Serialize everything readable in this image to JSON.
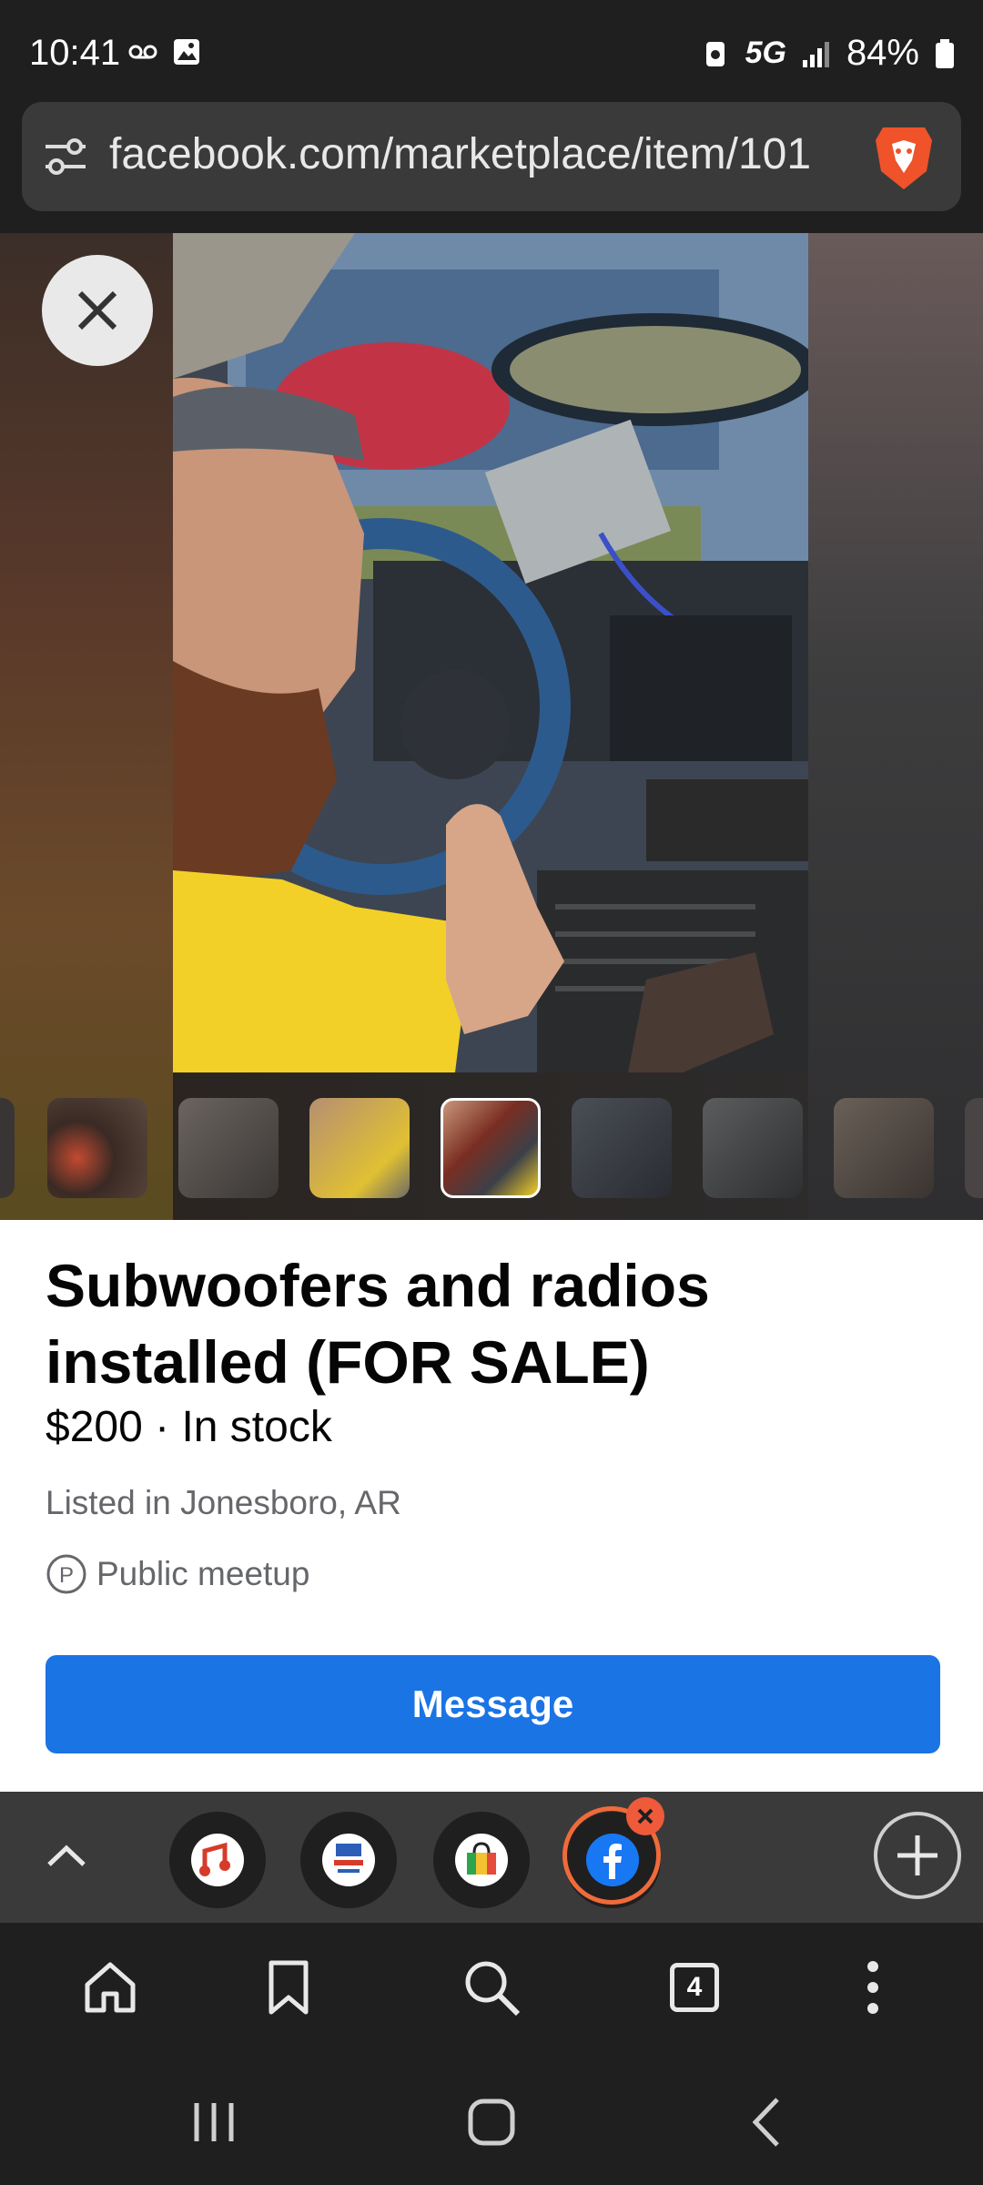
{
  "status_bar": {
    "time": "10:41",
    "network": "5G",
    "battery": "84%"
  },
  "url_bar": {
    "url": "facebook.com/marketplace/item/101"
  },
  "listing": {
    "title": "Subwoofers and radios installed (FOR SALE)",
    "price_line": "$200 · In stock",
    "location": "Listed in Jonesboro, AR",
    "meetup": "Public meetup",
    "message_button": "Message"
  },
  "thumbnails": {
    "count": 8,
    "selected_index": 3
  },
  "tab_strip": {
    "tabs": [
      "music-app-tab",
      "diy-mobile-audio-tab",
      "shop-bag-tab",
      "facebook-tab"
    ],
    "active_tab": "facebook-tab"
  },
  "browser_nav": {
    "tab_count": "4"
  },
  "colors": {
    "accent_blue": "#1b74e4",
    "brave_orange": "#f06a3a",
    "chrome_dark": "#1f1f1f"
  }
}
